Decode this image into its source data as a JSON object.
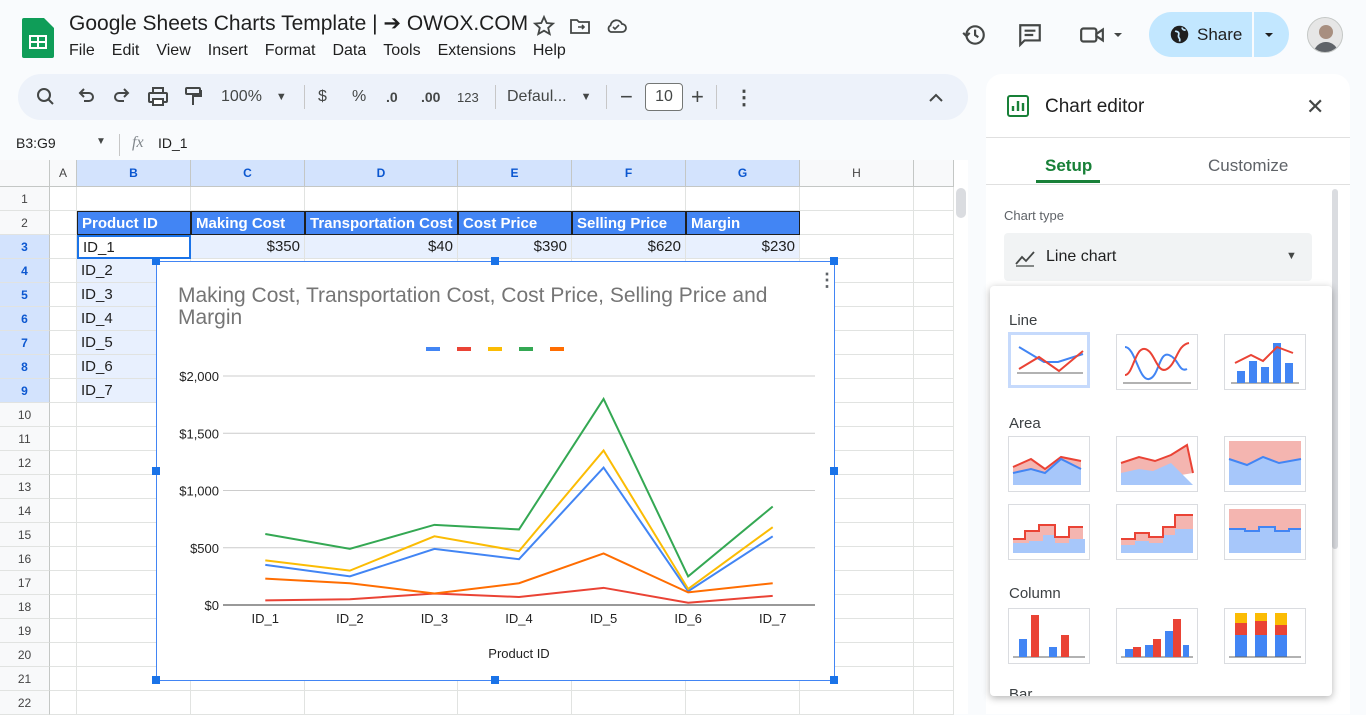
{
  "app": {
    "title": "Google Sheets Charts Template | ➔ OWOX.COM",
    "menus": [
      "File",
      "Edit",
      "View",
      "Insert",
      "Format",
      "Data",
      "Tools",
      "Extensions",
      "Help"
    ],
    "share_label": "Share"
  },
  "toolbar": {
    "zoom": "100%",
    "currency": "$",
    "percent": "%",
    "decrease_decimal": ".0",
    "increase_decimal": ".00",
    "number_format": "123",
    "font": "Defaul...",
    "font_size": "10"
  },
  "formula_bar": {
    "name_box": "B3:G9",
    "fx": "fx",
    "value": "ID_1"
  },
  "sheet": {
    "columns": [
      "A",
      "B",
      "C",
      "D",
      "E",
      "F",
      "G",
      "H"
    ],
    "rows": [
      "1",
      "2",
      "3",
      "4",
      "5",
      "6",
      "7",
      "8",
      "9",
      "10",
      "11",
      "12",
      "13",
      "14",
      "15",
      "16",
      "17",
      "18",
      "19",
      "20",
      "21",
      "22"
    ],
    "headers": [
      "Product ID",
      "Making Cost",
      "Transportation Cost",
      "Cost Price",
      "Selling Price",
      "Margin"
    ],
    "row1": [
      "ID_1",
      "$350",
      "$40",
      "$390",
      "$620",
      "$230"
    ],
    "ids": [
      "ID_2",
      "ID_3",
      "ID_4",
      "ID_5",
      "ID_6",
      "ID_7"
    ]
  },
  "chart_data": {
    "type": "line",
    "title": "Making Cost, Transportation Cost, Cost Price, Selling Price and Margin",
    "xlabel": "Product ID",
    "ylabel": "",
    "categories": [
      "ID_1",
      "ID_2",
      "ID_3",
      "ID_4",
      "ID_5",
      "ID_6",
      "ID_7"
    ],
    "yticks": [
      "$0",
      "$500",
      "$1,000",
      "$1,500",
      "$2,000"
    ],
    "ylim": [
      0,
      2000
    ],
    "grid": true,
    "legend": "top",
    "series": [
      {
        "color": "#4285f4",
        "values": [
          350,
          250,
          490,
          400,
          1200,
          120,
          600
        ]
      },
      {
        "color": "#ea4335",
        "values": [
          40,
          50,
          100,
          70,
          150,
          20,
          80
        ]
      },
      {
        "color": "#fbbc04",
        "values": [
          390,
          300,
          600,
          470,
          1350,
          140,
          680
        ]
      },
      {
        "color": "#34a853",
        "values": [
          620,
          490,
          700,
          660,
          1800,
          250,
          860
        ]
      },
      {
        "color": "#ff6d01",
        "values": [
          230,
          190,
          100,
          190,
          450,
          110,
          190
        ]
      }
    ]
  },
  "panel": {
    "title": "Chart editor",
    "tabs": [
      "Setup",
      "Customize"
    ],
    "chart_type_label": "Chart type",
    "chart_type_value": "Line chart",
    "sections": [
      "Line",
      "Area",
      "Column",
      "Bar"
    ]
  }
}
